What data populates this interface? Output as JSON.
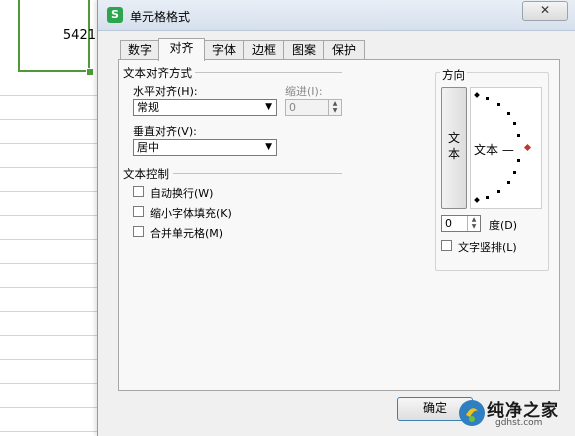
{
  "sheet": {
    "cell_value": "5421",
    "accent": "#4e9a3a"
  },
  "dialog": {
    "title": "单元格格式",
    "app_icon": "S",
    "close_icon": "close-icon",
    "close_glyph": "✕",
    "tabs": [
      {
        "label": "数字"
      },
      {
        "label": "对齐",
        "active": true
      },
      {
        "label": "字体"
      },
      {
        "label": "边框"
      },
      {
        "label": "图案"
      },
      {
        "label": "保护"
      }
    ],
    "alignment": {
      "section_title": "文本对齐方式",
      "horizontal_label": "水平对齐(H):",
      "horizontal_value": "常规",
      "indent_label": "缩进(I):",
      "indent_value": "0",
      "vertical_label": "垂直对齐(V):",
      "vertical_value": "居中"
    },
    "text_control": {
      "section_title": "文本控制",
      "options": [
        {
          "label": "自动换行(W)",
          "checked": false
        },
        {
          "label": "缩小字体填充(K)",
          "checked": false
        },
        {
          "label": "合并单元格(M)",
          "checked": false
        }
      ]
    },
    "orientation": {
      "section_title": "方向",
      "vertical_text_chars": [
        "文",
        "本"
      ],
      "dial_text": "文本 —",
      "degree_value": "0",
      "degree_label": "度(D)",
      "vertical_layout_label": "文字竖排(L)",
      "vertical_layout_checked": false,
      "marker_color": "#c0392b"
    },
    "ok_label": "确定"
  },
  "watermark": {
    "title": "纯净之家",
    "url": "gdhst.com"
  }
}
